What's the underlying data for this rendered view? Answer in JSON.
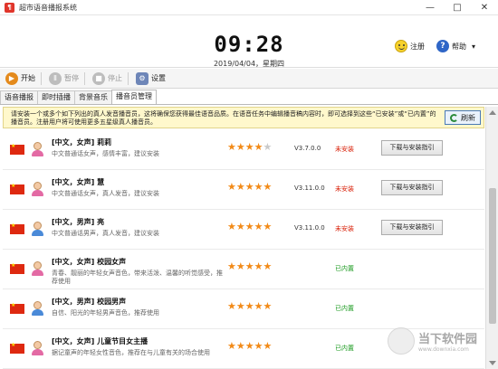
{
  "window": {
    "icon_glyph": "¶",
    "title": "超市语音播报系统",
    "minimize": "—",
    "maximize": "□",
    "close": "✕"
  },
  "clock": {
    "time": "09:28",
    "date": "2019/04/04，星期四"
  },
  "header": {
    "register": "注册",
    "help": "帮助",
    "help_arrow": "▾"
  },
  "toolbar": {
    "start": "开始",
    "start_icon": "play-icon",
    "pause": "暂停",
    "pause_icon": "pause-icon",
    "stop": "停止",
    "stop_icon": "stop-icon",
    "settings": "设置",
    "settings_icon": "gear-icon"
  },
  "tabs": [
    "语音播报",
    "即时插播",
    "背景音乐",
    "播音员管理"
  ],
  "active_tab": 3,
  "notice": {
    "text": "请安装一个或多个如下列出的真人发音播音员，这将确保您获得最佳语音品质。在语音任务中编辑播音稿内容时，即可选择到这些“已安装”或“已内置”的播音员。注册用户将可使用更多五星级真人播音员。",
    "refresh": "刷新"
  },
  "colors": {
    "orange_star": "#f28a17",
    "grey_star": "#c9c9c9",
    "red_status": "#d81e06",
    "green_status": "#199a1e",
    "notice_bg": "#fff8cc"
  },
  "announcers": [
    {
      "name": "[中文，女声] 莉莉",
      "desc": "中文普通话女声，感情丰富，建议安装",
      "rating": 4,
      "gender": "female",
      "version": "V3.7.0.0",
      "status": "未安装",
      "status_type": "red",
      "button": "下载与安装指引"
    },
    {
      "name": "[中文，女声] 慧",
      "desc": "中文普通话女声，真人发音，建议安装",
      "rating": 5,
      "gender": "female",
      "version": "V3.11.0.0",
      "status": "未安装",
      "status_type": "red",
      "button": "下载与安装指引"
    },
    {
      "name": "[中文，男声] 亮",
      "desc": "中文普通话男声，真人发音，建议安装",
      "rating": 5,
      "gender": "male",
      "version": "V3.11.0.0",
      "status": "未安装",
      "status_type": "red",
      "button": "下载与安装指引"
    },
    {
      "name": "[中文，女声] 校园女声",
      "desc": "青春、靓丽的年轻女声音色，带来活泼、温馨的听觉感受，推荐使用",
      "rating": 5,
      "gender": "female",
      "version": "",
      "status": "已内置",
      "status_type": "green",
      "button": ""
    },
    {
      "name": "[中文，男声] 校园男声",
      "desc": "自信、阳光的年轻男声音色，推荐使用",
      "rating": 5,
      "gender": "male",
      "version": "",
      "status": "已内置",
      "status_type": "green",
      "button": ""
    },
    {
      "name": "[中文，女声] 儿童节目女主播",
      "desc": "据记童声的年轻女性音色，推荐在与儿童有关的场合使用",
      "rating": 5,
      "gender": "female",
      "version": "",
      "status": "已内置",
      "status_type": "green",
      "button": ""
    }
  ],
  "watermark": {
    "icon": "logo-icon",
    "title": "当下软件园",
    "subtitle": "www.downxia.com"
  }
}
